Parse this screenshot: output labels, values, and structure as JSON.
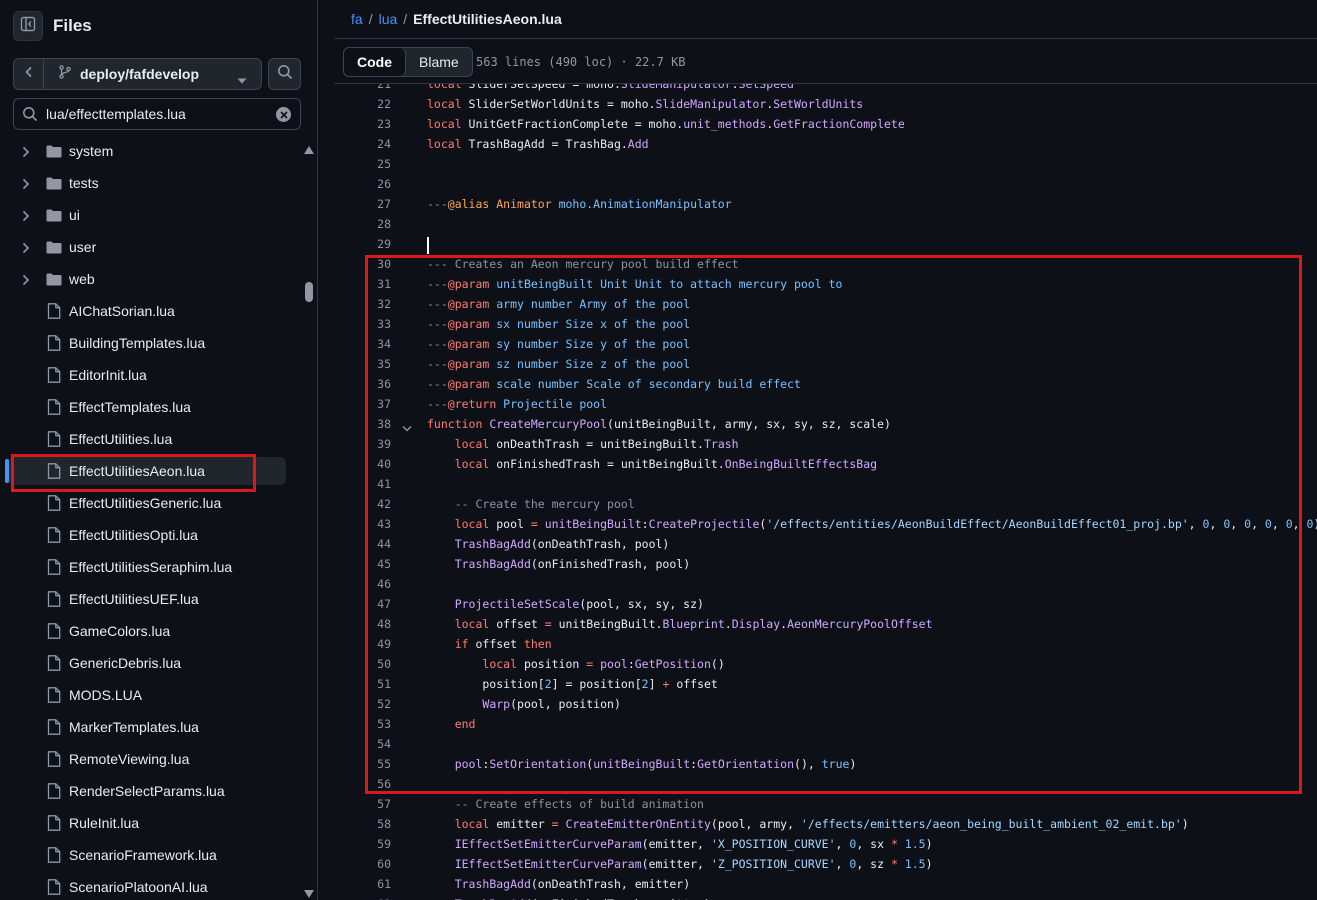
{
  "sidebar": {
    "title": "Files",
    "branch": "deploy/fafdevelop",
    "file_filter_value": "lua/effecttemplates.lua",
    "tree": [
      {
        "label": "system",
        "type": "dir"
      },
      {
        "label": "tests",
        "type": "dir"
      },
      {
        "label": "ui",
        "type": "dir"
      },
      {
        "label": "user",
        "type": "dir"
      },
      {
        "label": "web",
        "type": "dir"
      },
      {
        "label": "AIChatSorian.lua",
        "type": "file"
      },
      {
        "label": "BuildingTemplates.lua",
        "type": "file"
      },
      {
        "label": "EditorInit.lua",
        "type": "file"
      },
      {
        "label": "EffectTemplates.lua",
        "type": "file"
      },
      {
        "label": "EffectUtilities.lua",
        "type": "file"
      },
      {
        "label": "EffectUtilitiesAeon.lua",
        "type": "file",
        "selected": true
      },
      {
        "label": "EffectUtilitiesGeneric.lua",
        "type": "file"
      },
      {
        "label": "EffectUtilitiesOpti.lua",
        "type": "file"
      },
      {
        "label": "EffectUtilitiesSeraphim.lua",
        "type": "file"
      },
      {
        "label": "EffectUtilitiesUEF.lua",
        "type": "file"
      },
      {
        "label": "GameColors.lua",
        "type": "file"
      },
      {
        "label": "GenericDebris.lua",
        "type": "file"
      },
      {
        "label": "MODS.LUA",
        "type": "file"
      },
      {
        "label": "MarkerTemplates.lua",
        "type": "file"
      },
      {
        "label": "RemoteViewing.lua",
        "type": "file"
      },
      {
        "label": "RenderSelectParams.lua",
        "type": "file"
      },
      {
        "label": "RuleInit.lua",
        "type": "file"
      },
      {
        "label": "ScenarioFramework.lua",
        "type": "file"
      },
      {
        "label": "ScenarioPlatoonAI.lua",
        "type": "file"
      }
    ]
  },
  "breadcrumb": {
    "repo": "fa",
    "sep": "/",
    "folder": "lua",
    "file": "EffectUtilitiesAeon.lua"
  },
  "toolbar": {
    "code_label": "Code",
    "blame_label": "Blame",
    "meta": "563 lines (490 loc) · 22.7 KB"
  },
  "code_lines": [
    {
      "n": "21",
      "tokens": [
        [
          "k",
          "local "
        ],
        [
          "t",
          "SliderSetSpeed = moho."
        ],
        [
          "f",
          "SlideManipulator"
        ],
        [
          "t",
          "."
        ],
        [
          "f",
          "SetSpeed"
        ]
      ]
    },
    {
      "n": "22",
      "tokens": [
        [
          "k",
          "local "
        ],
        [
          "t",
          "SliderSetWorldUnits = moho."
        ],
        [
          "f",
          "SlideManipulator"
        ],
        [
          "t",
          "."
        ],
        [
          "f",
          "SetWorldUnits"
        ]
      ]
    },
    {
      "n": "23",
      "tokens": [
        [
          "k",
          "local "
        ],
        [
          "t",
          "UnitGetFractionComplete = moho."
        ],
        [
          "f",
          "unit_methods"
        ],
        [
          "t",
          "."
        ],
        [
          "f",
          "GetFractionComplete"
        ]
      ]
    },
    {
      "n": "24",
      "tokens": [
        [
          "k",
          "local "
        ],
        [
          "t",
          "TrashBagAdd = TrashBag."
        ],
        [
          "f",
          "Add"
        ]
      ]
    },
    {
      "n": "25",
      "tokens": []
    },
    {
      "n": "26",
      "tokens": []
    },
    {
      "n": "27",
      "tokens": [
        [
          "c",
          "---"
        ],
        [
          "ct",
          "@alias "
        ],
        [
          "ct",
          "Animator "
        ],
        [
          "ca",
          "moho.AnimationManipulator"
        ]
      ]
    },
    {
      "n": "28",
      "tokens": []
    },
    {
      "n": "29",
      "tokens": [],
      "cursor": true
    },
    {
      "n": "30",
      "tokens": [
        [
          "c",
          "--- Creates an Aeon mercury pool build effect"
        ]
      ]
    },
    {
      "n": "31",
      "tokens": [
        [
          "c",
          "---"
        ],
        [
          "k",
          "@param "
        ],
        [
          "ca",
          "unitBeingBuilt Unit Unit to attach mercury pool to"
        ]
      ]
    },
    {
      "n": "32",
      "tokens": [
        [
          "c",
          "---"
        ],
        [
          "k",
          "@param "
        ],
        [
          "ca",
          "army number Army of the pool"
        ]
      ]
    },
    {
      "n": "33",
      "tokens": [
        [
          "c",
          "---"
        ],
        [
          "k",
          "@param "
        ],
        [
          "ca",
          "sx number Size x of the pool"
        ]
      ]
    },
    {
      "n": "34",
      "tokens": [
        [
          "c",
          "---"
        ],
        [
          "k",
          "@param "
        ],
        [
          "ca",
          "sy number Size y of the pool"
        ]
      ]
    },
    {
      "n": "35",
      "tokens": [
        [
          "c",
          "---"
        ],
        [
          "k",
          "@param "
        ],
        [
          "ca",
          "sz number Size z of the pool"
        ]
      ]
    },
    {
      "n": "36",
      "tokens": [
        [
          "c",
          "---"
        ],
        [
          "k",
          "@param "
        ],
        [
          "ca",
          "scale number Scale of secondary build effect"
        ]
      ]
    },
    {
      "n": "37",
      "tokens": [
        [
          "c",
          "---"
        ],
        [
          "k",
          "@return "
        ],
        [
          "ca",
          "Projectile pool"
        ]
      ]
    },
    {
      "n": "38",
      "fold": true,
      "tokens": [
        [
          "k",
          "function "
        ],
        [
          "f",
          "CreateMercuryPool"
        ],
        [
          "t",
          "(unitBeingBuilt, army, sx, sy, sz, scale)"
        ]
      ]
    },
    {
      "n": "39",
      "tokens": [
        [
          "t",
          "    "
        ],
        [
          "k",
          "local "
        ],
        [
          "t",
          "onDeathTrash = unitBeingBuilt."
        ],
        [
          "f",
          "Trash"
        ]
      ]
    },
    {
      "n": "40",
      "tokens": [
        [
          "t",
          "    "
        ],
        [
          "k",
          "local "
        ],
        [
          "t",
          "onFinishedTrash = unitBeingBuilt."
        ],
        [
          "f",
          "OnBeingBuiltEffectsBag"
        ]
      ]
    },
    {
      "n": "41",
      "tokens": []
    },
    {
      "n": "42",
      "tokens": [
        [
          "t",
          "    "
        ],
        [
          "c",
          "-- Create the mercury pool"
        ]
      ]
    },
    {
      "n": "43",
      "tokens": [
        [
          "t",
          "    "
        ],
        [
          "k",
          "local "
        ],
        [
          "t",
          "pool "
        ],
        [
          "k",
          "= "
        ],
        [
          "f",
          "unitBeingBuilt"
        ],
        [
          "t",
          ":"
        ],
        [
          "f",
          "CreateProjectile"
        ],
        [
          "t",
          "("
        ],
        [
          "s",
          "'/effects/entities/AeonBuildEffect/AeonBuildEffect01_proj.bp'"
        ],
        [
          "t",
          ", "
        ],
        [
          "n",
          "0"
        ],
        [
          "t",
          ", "
        ],
        [
          "n",
          "0"
        ],
        [
          "t",
          ", "
        ],
        [
          "n",
          "0"
        ],
        [
          "t",
          ", "
        ],
        [
          "n",
          "0"
        ],
        [
          "t",
          ", "
        ],
        [
          "n",
          "0"
        ],
        [
          "t",
          ", "
        ],
        [
          "n",
          "0"
        ],
        [
          "t",
          ")"
        ]
      ]
    },
    {
      "n": "44",
      "tokens": [
        [
          "t",
          "    "
        ],
        [
          "f",
          "TrashBagAdd"
        ],
        [
          "t",
          "(onDeathTrash, pool)"
        ]
      ]
    },
    {
      "n": "45",
      "tokens": [
        [
          "t",
          "    "
        ],
        [
          "f",
          "TrashBagAdd"
        ],
        [
          "t",
          "(onFinishedTrash, pool)"
        ]
      ]
    },
    {
      "n": "46",
      "tokens": []
    },
    {
      "n": "47",
      "tokens": [
        [
          "t",
          "    "
        ],
        [
          "f",
          "ProjectileSetScale"
        ],
        [
          "t",
          "(pool, sx, sy, sz)"
        ]
      ]
    },
    {
      "n": "48",
      "tokens": [
        [
          "t",
          "    "
        ],
        [
          "k",
          "local "
        ],
        [
          "t",
          "offset "
        ],
        [
          "k",
          "= "
        ],
        [
          "t",
          "unitBeingBuilt."
        ],
        [
          "f",
          "Blueprint"
        ],
        [
          "t",
          "."
        ],
        [
          "f",
          "Display"
        ],
        [
          "t",
          "."
        ],
        [
          "f",
          "AeonMercuryPoolOffset"
        ]
      ]
    },
    {
      "n": "49",
      "tokens": [
        [
          "t",
          "    "
        ],
        [
          "k",
          "if "
        ],
        [
          "t",
          "offset "
        ],
        [
          "k",
          "then"
        ]
      ]
    },
    {
      "n": "50",
      "tokens": [
        [
          "t",
          "        "
        ],
        [
          "k",
          "local "
        ],
        [
          "t",
          "position "
        ],
        [
          "k",
          "= "
        ],
        [
          "f",
          "pool"
        ],
        [
          "t",
          ":"
        ],
        [
          "f",
          "GetPosition"
        ],
        [
          "t",
          "()"
        ]
      ]
    },
    {
      "n": "51",
      "tokens": [
        [
          "t",
          "        position["
        ],
        [
          "n",
          "2"
        ],
        [
          "t",
          "] = position["
        ],
        [
          "n",
          "2"
        ],
        [
          "t",
          "] "
        ],
        [
          "k",
          "+ "
        ],
        [
          "t",
          "offset"
        ]
      ]
    },
    {
      "n": "52",
      "tokens": [
        [
          "t",
          "        "
        ],
        [
          "f",
          "Warp"
        ],
        [
          "t",
          "(pool, position)"
        ]
      ]
    },
    {
      "n": "53",
      "tokens": [
        [
          "t",
          "    "
        ],
        [
          "k",
          "end"
        ]
      ]
    },
    {
      "n": "54",
      "tokens": []
    },
    {
      "n": "55",
      "tokens": [
        [
          "t",
          "    "
        ],
        [
          "f",
          "pool"
        ],
        [
          "t",
          ":"
        ],
        [
          "f",
          "SetOrientation"
        ],
        [
          "t",
          "("
        ],
        [
          "f",
          "unitBeingBuilt"
        ],
        [
          "t",
          ":"
        ],
        [
          "f",
          "GetOrientation"
        ],
        [
          "t",
          "(), "
        ],
        [
          "n",
          "true"
        ],
        [
          "t",
          ")"
        ]
      ]
    },
    {
      "n": "56",
      "tokens": []
    },
    {
      "n": "57",
      "tokens": [
        [
          "t",
          "    "
        ],
        [
          "c",
          "-- Create effects of build animation"
        ]
      ]
    },
    {
      "n": "58",
      "tokens": [
        [
          "t",
          "    "
        ],
        [
          "k",
          "local "
        ],
        [
          "t",
          "emitter "
        ],
        [
          "k",
          "= "
        ],
        [
          "f",
          "CreateEmitterOnEntity"
        ],
        [
          "t",
          "(pool, army, "
        ],
        [
          "s",
          "'/effects/emitters/aeon_being_built_ambient_02_emit.bp'"
        ],
        [
          "t",
          ")"
        ]
      ]
    },
    {
      "n": "59",
      "tokens": [
        [
          "t",
          "    "
        ],
        [
          "f",
          "IEffectSetEmitterCurveParam"
        ],
        [
          "t",
          "(emitter, "
        ],
        [
          "s",
          "'X_POSITION_CURVE'"
        ],
        [
          "t",
          ", "
        ],
        [
          "n",
          "0"
        ],
        [
          "t",
          ", sx "
        ],
        [
          "k",
          "* "
        ],
        [
          "n",
          "1.5"
        ],
        [
          "t",
          ")"
        ]
      ]
    },
    {
      "n": "60",
      "tokens": [
        [
          "t",
          "    "
        ],
        [
          "f",
          "IEffectSetEmitterCurveParam"
        ],
        [
          "t",
          "(emitter, "
        ],
        [
          "s",
          "'Z_POSITION_CURVE'"
        ],
        [
          "t",
          ", "
        ],
        [
          "n",
          "0"
        ],
        [
          "t",
          ", sz "
        ],
        [
          "k",
          "* "
        ],
        [
          "n",
          "1.5"
        ],
        [
          "t",
          ")"
        ]
      ]
    },
    {
      "n": "61",
      "tokens": [
        [
          "t",
          "    "
        ],
        [
          "f",
          "TrashBagAdd"
        ],
        [
          "t",
          "(onDeathTrash, emitter)"
        ]
      ]
    },
    {
      "n": "62",
      "tokens": [
        [
          "t",
          "    "
        ],
        [
          "f",
          "TrashBagAdd"
        ],
        [
          "t",
          "(onFinishedTrash, emitter)"
        ]
      ]
    }
  ],
  "colors": {
    "accent": "#4493f8",
    "annotation_red": "#d9191c"
  }
}
